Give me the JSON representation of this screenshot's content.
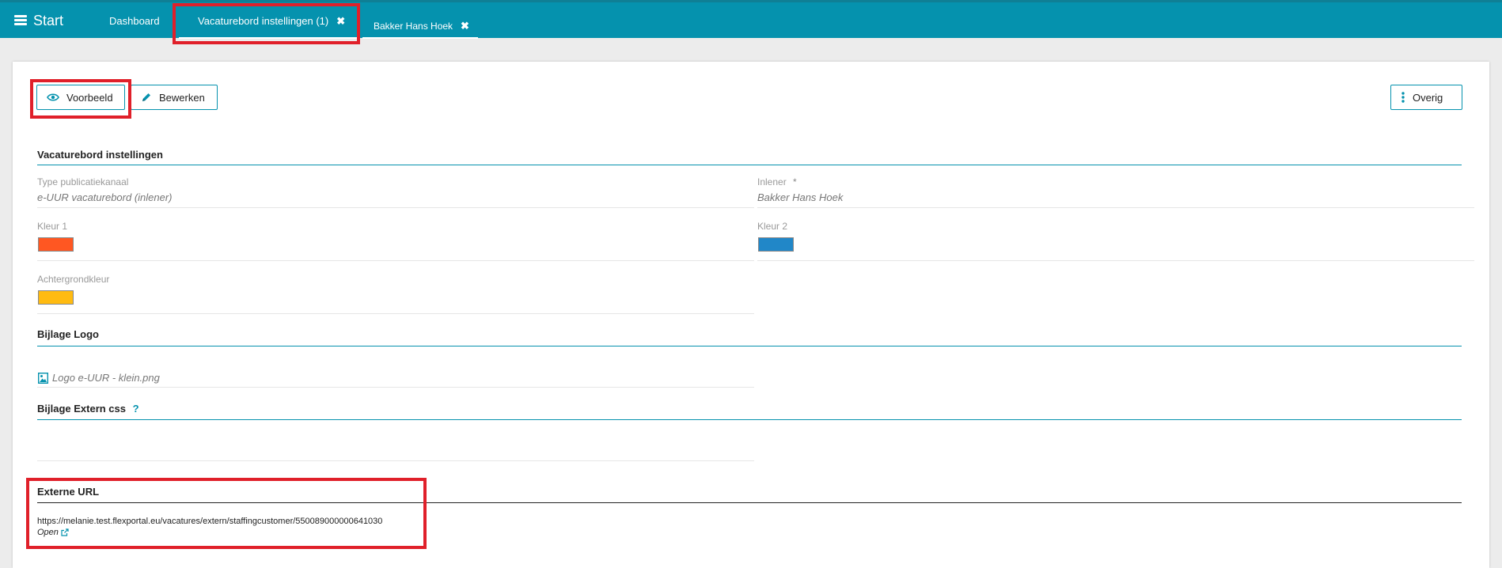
{
  "header": {
    "start_label": "Start",
    "tabs": [
      {
        "label": "Dashboard"
      },
      {
        "label": "Vacaturebord instellingen (1)"
      },
      {
        "label": "Bakker Hans Hoek"
      }
    ]
  },
  "toolbar": {
    "preview_label": "Voorbeeld",
    "edit_label": "Bewerken",
    "more_label": "Overig"
  },
  "section_settings": {
    "title": "Vacaturebord instellingen",
    "type_label": "Type publicatiekanaal",
    "type_value": "e-UUR vacaturebord (inlener)",
    "inlener_label": "Inlener",
    "inlener_required": "*",
    "inlener_value": "Bakker Hans Hoek",
    "kleur1_label": "Kleur 1",
    "kleur1_color": "#ff5722",
    "kleur2_label": "Kleur 2",
    "kleur2_color": "#2187c8",
    "achtergrond_label": "Achtergrondkleur",
    "achtergrond_color": "#ffbb11"
  },
  "section_logo": {
    "title": "Bijlage Logo",
    "file_name": "Logo e-UUR - klein.png"
  },
  "section_css": {
    "title": "Bijlage Extern css",
    "help": "?"
  },
  "section_url": {
    "title": "Externe URL",
    "url": "https://melanie.test.flexportal.eu/vacatures/extern/staffingcustomer/550089000000641030",
    "open_label": "Open"
  },
  "colors": {
    "accent": "#0592ae",
    "highlight": "#e0202a"
  }
}
